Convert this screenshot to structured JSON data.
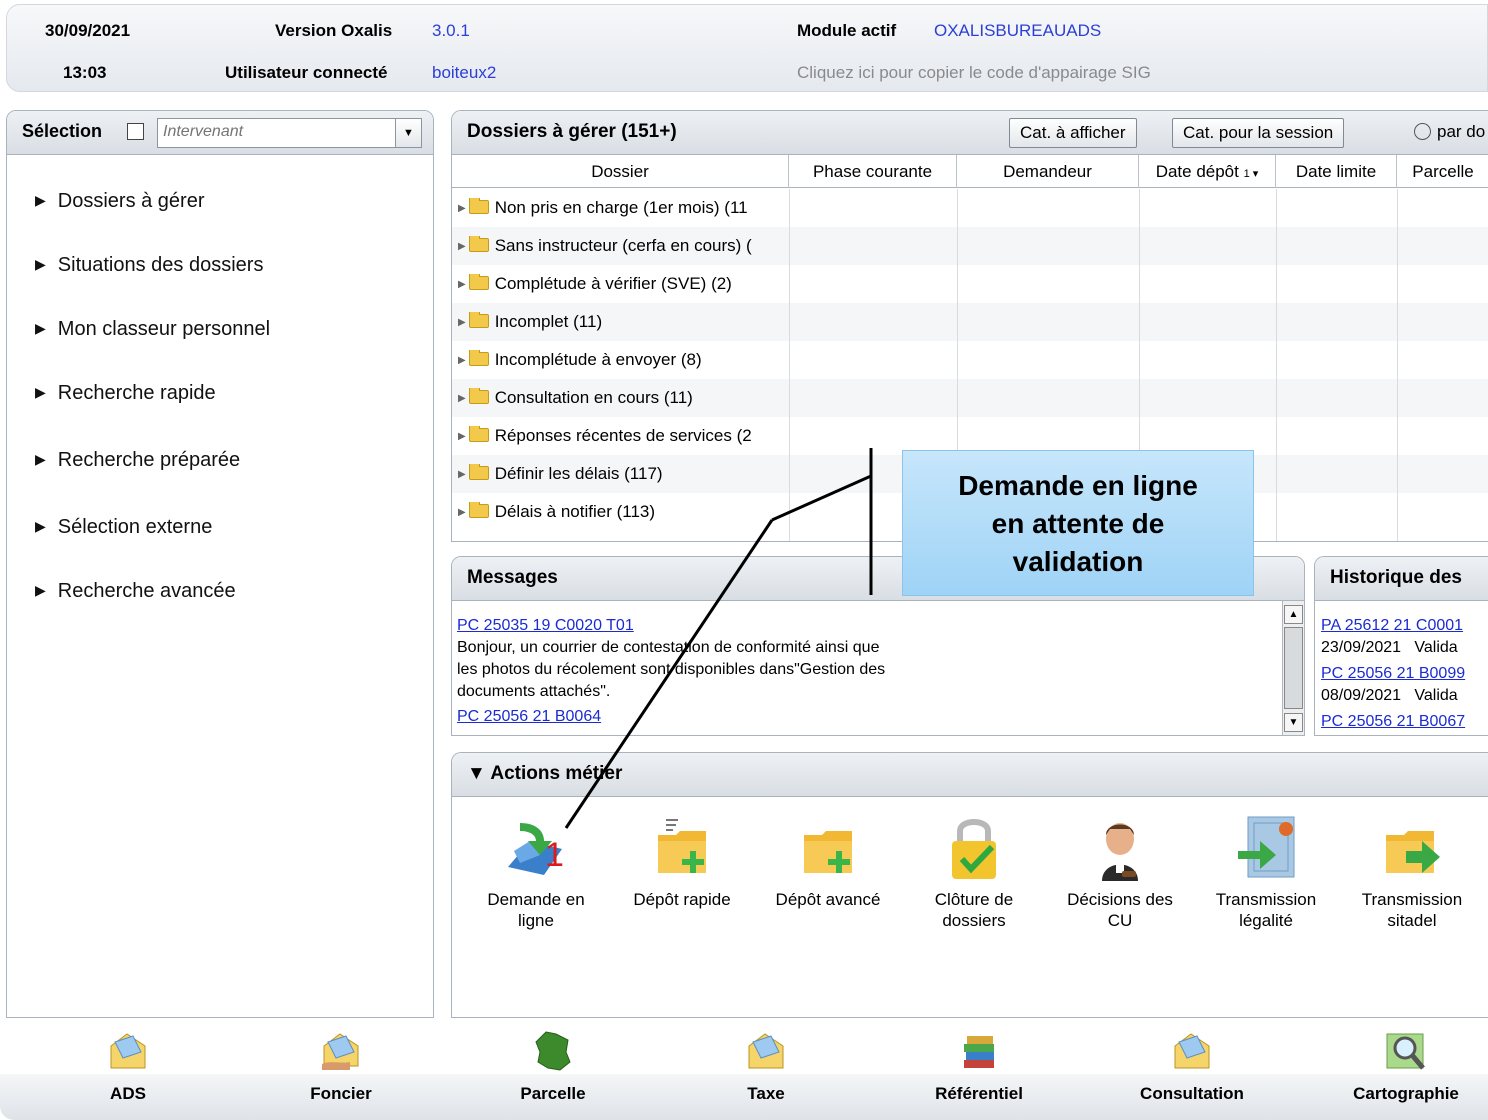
{
  "header": {
    "date": "30/09/2021",
    "time": "13:03",
    "version_label": "Version Oxalis",
    "version_value": "3.0.1",
    "user_label": "Utilisateur connecté",
    "user_value": "boiteux2",
    "module_label": "Module actif",
    "module_value": "OXALISBUREAUADS",
    "sig_link": "Cliquez ici pour copier le code d'appairage SIG"
  },
  "left": {
    "selection_label": "Sélection",
    "combo_placeholder": "Intervenant",
    "items": [
      "Dossiers à gérer",
      "Situations des dossiers",
      "Mon classeur personnel",
      "Recherche rapide",
      "Recherche préparée",
      "Sélection externe",
      "Recherche avancée"
    ]
  },
  "dossiers": {
    "title": "Dossiers à gérer (151+)",
    "btn_cat_afficher": "Cat. à afficher",
    "btn_cat_session": "Cat. pour la session",
    "radio_label": "par do",
    "columns": [
      "Dossier",
      "Phase courante",
      "Demandeur",
      "Date dépôt",
      "Date limite",
      "Parcelle"
    ],
    "sort_indicator": "1 ▾",
    "rows": [
      "Non pris en charge (1er mois) (11",
      "Sans instructeur (cerfa en cours) (",
      "Complétude à vérifier (SVE) (2)",
      "Incomplet (11)",
      "Incomplétude à envoyer (8)",
      "Consultation en cours (11)",
      "Réponses récentes de services (2",
      "Définir les délais (117)",
      "Délais à notifier (113)"
    ]
  },
  "messages": {
    "title": "Messages",
    "link1": "PC 25035 19 C0020 T01",
    "text1a": "Bonjour, un courrier de contestation de conformité ainsi que",
    "text1b": "les photos du récolement sont disponibles dans\"Gestion des",
    "text1c": "documents attachés\".",
    "link2": "PC 25056 21 B0064"
  },
  "historique": {
    "title": "Historique des",
    "link1": "PA 25612 21 C0001",
    "line1": "23/09/2021   Valida",
    "link2": "PC 25056 21 B0099",
    "line2": "08/09/2021   Valida",
    "link3": "PC 25056 21 B0067"
  },
  "actions": {
    "title": "▼ Actions métier",
    "items": [
      {
        "l1": "Demande en",
        "l2": "ligne",
        "icon": "online-request-icon"
      },
      {
        "l1": "Dépôt rapide",
        "l2": "",
        "icon": "quick-deposit-icon"
      },
      {
        "l1": "Dépôt avancé",
        "l2": "",
        "icon": "advanced-deposit-icon"
      },
      {
        "l1": "Clôture de",
        "l2": "dossiers",
        "icon": "lock-icon"
      },
      {
        "l1": "Décisions des",
        "l2": "CU",
        "icon": "judge-icon"
      },
      {
        "l1": "Transmission",
        "l2": "légalité",
        "icon": "certificate-icon"
      },
      {
        "l1": "Transmission",
        "l2": "sitadel",
        "icon": "folder-arrow-icon"
      }
    ]
  },
  "bottom_nav": [
    "ADS",
    "Foncier",
    "Parcelle",
    "Taxe",
    "Référentiel",
    "Consultation",
    "Cartographie"
  ],
  "annotation": {
    "callout_l1": "Demande en ligne",
    "callout_l2": "en attente de",
    "callout_l3": "validation",
    "badge": "1"
  },
  "colors": {
    "link_blue": "#1a2bd1",
    "header_blue": "#2b3fd6",
    "callout_blue": "#aedaf8",
    "badge_red": "#e01a1a"
  }
}
